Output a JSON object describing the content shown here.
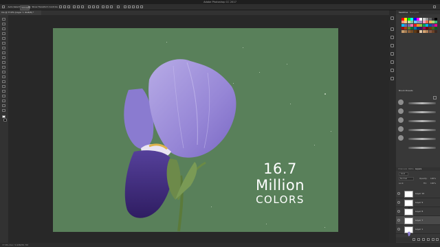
{
  "app": {
    "title": "Adobe Photoshop CC 2017"
  },
  "options_bar": {
    "auto_select_label": "Auto-Select:",
    "auto_select_value": "Group",
    "show_transform_label": "Show Transform Controls"
  },
  "document_tab": {
    "label": "Iris @ 77.8% (Layer 7, RGB/8) *"
  },
  "canvas": {
    "line1": "16.7 Million",
    "line2": "COLORS",
    "background_color": "#59805a"
  },
  "status_bar": {
    "text": "77.8%   Doc: 5.93M/55.7M"
  },
  "panels": {
    "swatches_tabs": [
      "Swatches",
      "Navigator"
    ],
    "brush_presets_title": "Brush Presets",
    "brush_sizes": [
      "25",
      "50",
      "25",
      "25",
      "36"
    ],
    "layers_tabs": [
      "Channels",
      "Paths",
      "Layers"
    ],
    "layers_kind_label": "Kind",
    "blend_mode": "Normal",
    "opacity_label": "Opacity:",
    "opacity_value": "100%",
    "lock_label": "Lock:",
    "fill_label": "Fill:",
    "fill_value": "100%",
    "layers": [
      "Layer 10",
      "Layer 9",
      "Layer 8",
      "Layer 7",
      "Layer 1"
    ]
  },
  "colors": {
    "accent": "#59805a",
    "petal": "#9a8ad8",
    "petal_dark": "#3e2a78"
  }
}
